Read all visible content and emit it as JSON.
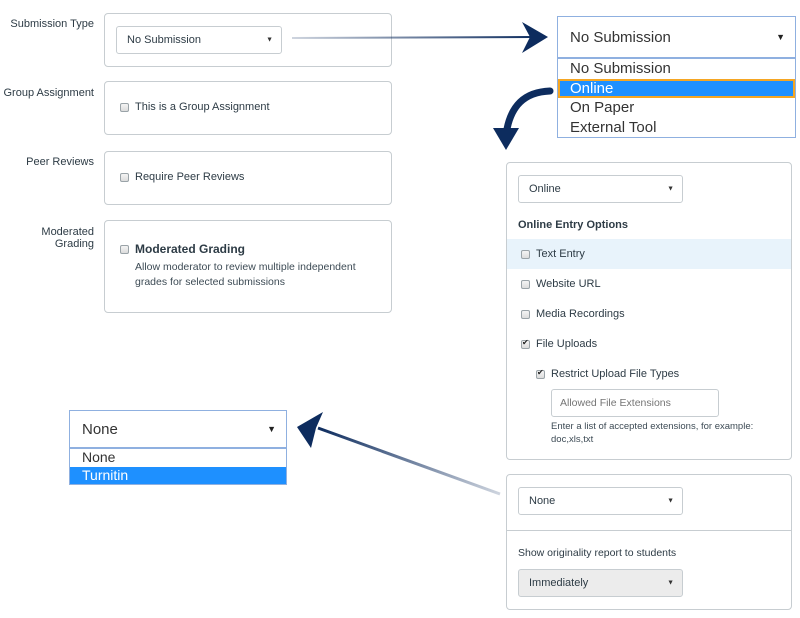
{
  "left_form": {
    "submission_type": {
      "label": "Submission Type",
      "select_value": "No Submission"
    },
    "group_assignment": {
      "label": "Group Assignment",
      "checkbox_label": "This is a Group Assignment",
      "checked": false
    },
    "peer_reviews": {
      "label": "Peer Reviews",
      "checkbox_label": "Require Peer Reviews",
      "checked": false
    },
    "moderated_grading": {
      "label": "Moderated Grading",
      "checkbox_label": "Moderated Grading",
      "description": "Allow moderator to review multiple independent grades for selected submissions",
      "checked": false
    }
  },
  "submission_dropdown_zoom": {
    "selected_value": "No Submission",
    "options": [
      "No Submission",
      "Online",
      "On Paper",
      "External Tool"
    ],
    "highlighted_option": "Online"
  },
  "online_panel": {
    "select_value": "Online",
    "section_title": "Online Entry Options",
    "options": [
      {
        "label": "Text Entry",
        "checked": false
      },
      {
        "label": "Website URL",
        "checked": false
      },
      {
        "label": "Media Recordings",
        "checked": false
      },
      {
        "label": "File Uploads",
        "checked": true
      }
    ],
    "restrict": {
      "label": "Restrict Upload File Types",
      "checked": true
    },
    "extensions_placeholder": "Allowed File Extensions",
    "extensions_help": "Enter a list of accepted extensions, for example: doc,xls,txt"
  },
  "plagiarism_dropdown_zoom": {
    "selected_value": "None",
    "options": [
      "None",
      "Turnitin"
    ],
    "highlighted_option": "Turnitin"
  },
  "plagiarism_panel": {
    "select_value": "None",
    "report_label": "Show originality report to students",
    "report_select_value": "Immediately"
  },
  "colors": {
    "arrow": "#0d2c5e",
    "selected_option": "#1e90ff",
    "highlight_outline": "#f5a623",
    "hover_row": "#e8f3fb"
  }
}
